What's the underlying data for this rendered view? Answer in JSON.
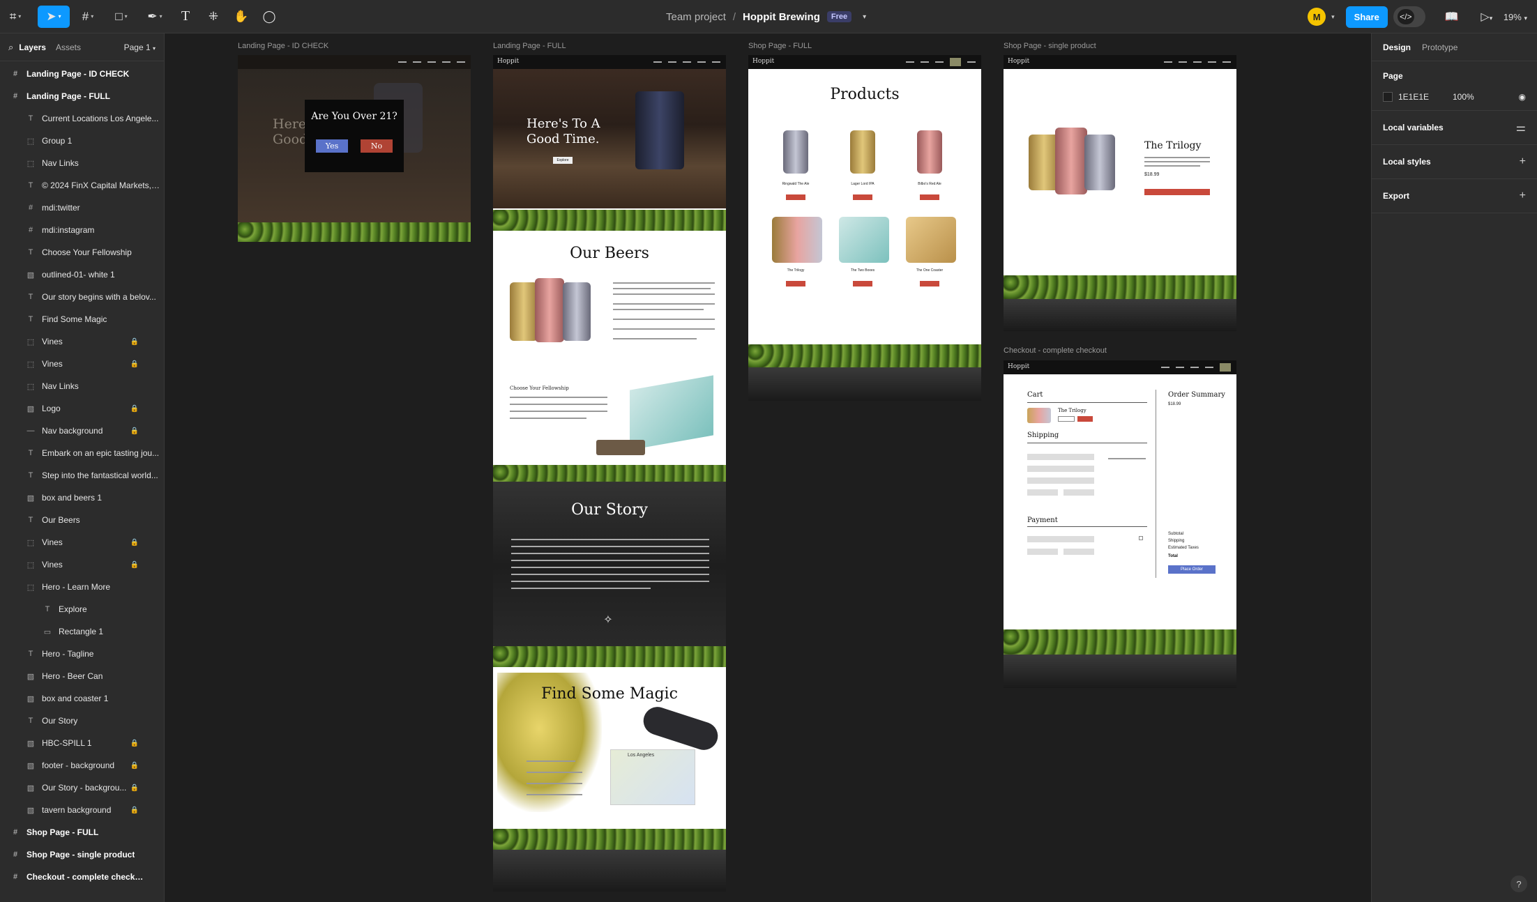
{
  "topbar": {
    "project": "Team project",
    "separator": "/",
    "file_name": "Hoppit Brewing",
    "plan_badge": "Free",
    "avatar_initial": "M",
    "share_label": "Share",
    "zoom": "19%",
    "accent_color": "#0d99ff"
  },
  "left_panel": {
    "tab_layers": "Layers",
    "tab_assets": "Assets",
    "page": "Page 1",
    "layers": [
      {
        "label": "Landing Page - ID CHECK",
        "icon": "frame-icon",
        "level": 0
      },
      {
        "label": "Landing Page - FULL",
        "icon": "frame-icon",
        "level": 0
      },
      {
        "label": "Current Locations Los Angele...",
        "icon": "text-icon",
        "level": 1
      },
      {
        "label": "Group 1",
        "icon": "group-icon",
        "level": 1
      },
      {
        "label": "Nav Links",
        "icon": "group-icon",
        "level": 1
      },
      {
        "label": "© 2024 FinX Capital Markets, ...",
        "icon": "text-icon",
        "level": 1
      },
      {
        "label": "mdi:twitter",
        "icon": "frame-icon",
        "level": 1
      },
      {
        "label": "mdi:instagram",
        "icon": "frame-icon",
        "level": 1
      },
      {
        "label": "Choose Your Fellowship",
        "icon": "text-icon",
        "level": 1
      },
      {
        "label": "outlined-01- white 1",
        "icon": "image-icon",
        "level": 1
      },
      {
        "label": "Our story begins with a belov...",
        "icon": "text-icon",
        "level": 1
      },
      {
        "label": "Find Some Magic",
        "icon": "text-icon",
        "level": 1
      },
      {
        "label": "Vines",
        "icon": "group-icon",
        "level": 1,
        "locked": true
      },
      {
        "label": "Vines",
        "icon": "group-icon",
        "level": 1,
        "locked": true
      },
      {
        "label": "Nav Links",
        "icon": "group-icon",
        "level": 1
      },
      {
        "label": "Logo",
        "icon": "image-icon",
        "level": 1,
        "locked": true
      },
      {
        "label": "Nav background",
        "icon": "line-icon",
        "level": 1,
        "locked": true
      },
      {
        "label": "Embark on an epic tasting jou...",
        "icon": "text-icon",
        "level": 1
      },
      {
        "label": "Step into the fantastical world...",
        "icon": "text-icon",
        "level": 1
      },
      {
        "label": "box and beers 1",
        "icon": "image-icon",
        "level": 1
      },
      {
        "label": "Our Beers",
        "icon": "text-icon",
        "level": 1
      },
      {
        "label": "Vines",
        "icon": "group-icon",
        "level": 1,
        "locked": true
      },
      {
        "label": "Vines",
        "icon": "group-icon",
        "level": 1,
        "locked": true
      },
      {
        "label": "Hero - Learn More",
        "icon": "group-icon",
        "level": 1
      },
      {
        "label": "Explore",
        "icon": "text-icon",
        "level": 2
      },
      {
        "label": "Rectangle 1",
        "icon": "rect-icon",
        "level": 2
      },
      {
        "label": "Hero - Tagline",
        "icon": "text-icon",
        "level": 1
      },
      {
        "label": "Hero - Beer Can",
        "icon": "image-icon",
        "level": 1
      },
      {
        "label": "box and coaster 1",
        "icon": "image-icon",
        "level": 1
      },
      {
        "label": "Our Story",
        "icon": "text-icon",
        "level": 1
      },
      {
        "label": "HBC-SPILL 1",
        "icon": "image-icon",
        "level": 1,
        "locked": true
      },
      {
        "label": "footer - background",
        "icon": "image-icon",
        "level": 1,
        "locked": true
      },
      {
        "label": "Our Story - backgrou...",
        "icon": "image-icon",
        "level": 1,
        "locked": true
      },
      {
        "label": "tavern background",
        "icon": "image-icon",
        "level": 1,
        "locked": true
      },
      {
        "label": "Shop Page - FULL",
        "icon": "frame-icon",
        "level": 0
      },
      {
        "label": "Shop Page - single product",
        "icon": "frame-icon",
        "level": 0
      },
      {
        "label": "Checkout - complete checkout",
        "icon": "frame-icon",
        "level": 0
      }
    ]
  },
  "right_panel": {
    "tab_design": "Design",
    "tab_prototype": "Prototype",
    "page_label": "Page",
    "page_color": "1E1E1E",
    "page_opacity": "100%",
    "local_variables": "Local variables",
    "local_styles": "Local styles",
    "export": "Export",
    "help": "?"
  },
  "canvas": {
    "frames": {
      "id_check": {
        "label": "Landing Page - ID CHECK",
        "modal_title": "Are You Over 21?",
        "yes": "Yes",
        "no": "No",
        "hero_text": "Here's A Good"
      },
      "landing_full": {
        "label": "Landing Page - FULL",
        "logo": "Hoppit",
        "hero_tagline": "Here's To A Good Time.",
        "explore": "Explore",
        "our_beers": "Our Beers",
        "choose_fellowship": "Choose Your Fellowship",
        "our_story": "Our Story",
        "find_magic": "Find Some Magic",
        "map_city": "Los Angeles"
      },
      "shop_full": {
        "label": "Shop Page - FULL",
        "logo": "Hoppit",
        "heading": "Products",
        "products": [
          "Ringwald The Ale",
          "Lager Lord IPA",
          "Bilbo's Red Ale",
          "The Trilogy",
          "The Two Boxes",
          "The One Coaster"
        ]
      },
      "shop_single": {
        "label": "Shop Page - single product",
        "logo": "Hoppit",
        "product": "The Trilogy",
        "price": "$18.99"
      },
      "checkout": {
        "label": "Checkout - complete checkout",
        "logo": "Hoppit",
        "cart": "Cart",
        "cart_item": "The Trilogy",
        "shipping": "Shipping",
        "payment": "Payment",
        "order_summary": "Order Summary",
        "price": "$18.99",
        "subtotal": "Subtotal",
        "shipping_line": "Shipping",
        "taxes": "Estimated Taxes",
        "total": "Total",
        "place_order": "Place Order"
      }
    }
  }
}
